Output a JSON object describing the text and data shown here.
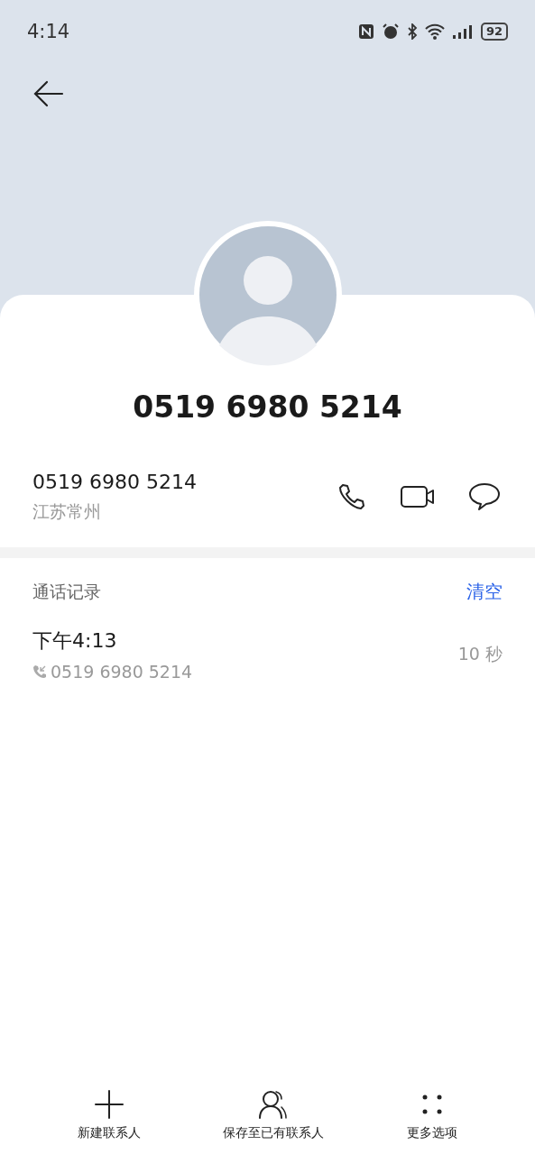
{
  "status_bar": {
    "time": "4:14",
    "battery": "92"
  },
  "contact": {
    "title": "0519 6980 5214",
    "number": "0519 6980 5214",
    "location": "江苏常州"
  },
  "call_log": {
    "heading": "通话记录",
    "clear_label": "清空",
    "entries": [
      {
        "time": "下午4:13",
        "number": "0519 6980 5214",
        "duration": "10 秒"
      }
    ]
  },
  "bottom_actions": [
    {
      "kind": "add",
      "label": "新建联系人"
    },
    {
      "kind": "person",
      "label": "保存至已有联系人"
    },
    {
      "kind": "more",
      "label": "更多选项"
    }
  ]
}
